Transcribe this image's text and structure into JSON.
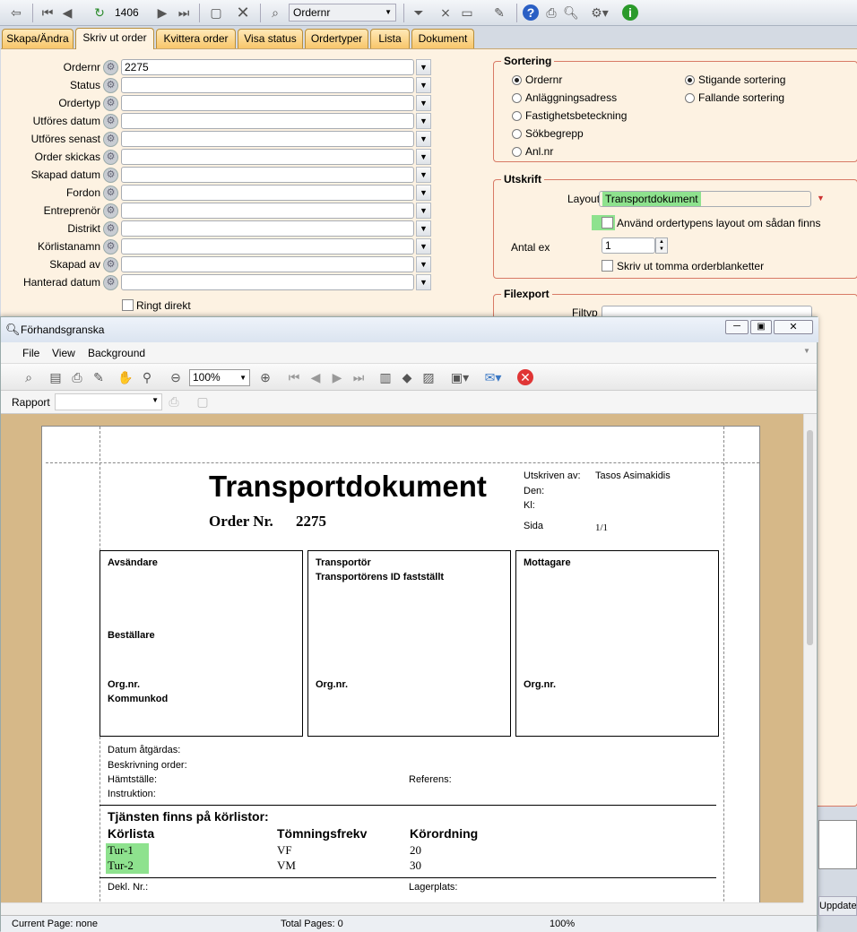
{
  "toolbar": {
    "record_counter": "1406",
    "search_field_value": "Ordernr"
  },
  "tabs": [
    "Skapa/Ändra",
    "Skriv ut order",
    "Kvittera order",
    "Visa status",
    "Ordertyper",
    "Lista",
    "Dokument"
  ],
  "form": {
    "fields": [
      {
        "label": "Ordernr",
        "value": "2275"
      },
      {
        "label": "Status",
        "value": ""
      },
      {
        "label": "Ordertyp",
        "value": ""
      },
      {
        "label": "Utföres datum",
        "value": ""
      },
      {
        "label": "Utföres senast",
        "value": ""
      },
      {
        "label": "Order skickas",
        "value": ""
      },
      {
        "label": "Skapad datum",
        "value": ""
      },
      {
        "label": "Fordon",
        "value": ""
      },
      {
        "label": "Entreprenör",
        "value": ""
      },
      {
        "label": "Distrikt",
        "value": ""
      },
      {
        "label": "Körlistanamn",
        "value": ""
      },
      {
        "label": "Skapad av",
        "value": ""
      },
      {
        "label": "Hanterad datum",
        "value": ""
      }
    ],
    "ringt_direkt": "Ringt direkt"
  },
  "sortering": {
    "title": "Sortering",
    "options": [
      "Ordernr",
      "Anläggningsadress",
      "Fastighetsbeteckning",
      "Sökbegrepp",
      "Anl.nr"
    ],
    "order_options": [
      "Stigande sortering",
      "Fallande sortering"
    ]
  },
  "utskrift": {
    "title": "Utskrift",
    "layout_label": "Layout",
    "layout_value": "Transportdokument",
    "use_type_layout": "Använd ordertypens layout om sådan finns",
    "antal_label": "Antal ex",
    "antal_value": "1",
    "print_empty": "Skriv ut tomma orderblanketter"
  },
  "filexport": {
    "title": "Filexport",
    "filtyp_label": "Filtyp"
  },
  "preview": {
    "title": "Förhandsgranska",
    "menu": [
      "File",
      "View",
      "Background"
    ],
    "zoom": "100%",
    "rapport_label": "Rapport",
    "status": [
      "Current Page: none",
      "Total Pages: 0",
      "100%"
    ],
    "side_label": "Uppdaterad"
  },
  "document": {
    "title": "Transportdokument",
    "order_label": "Order Nr.",
    "order_number": "2275",
    "printed_by_label": "Utskriven av:",
    "printed_by": "Tasos Asimakidis",
    "date_label": "Den:",
    "time_label": "Kl:",
    "page_label": "Sida",
    "page_value": "1/1",
    "sender": "Avsändare",
    "orderer": "Beställare",
    "orgnr": "Org.nr.",
    "kommunkod": "Kommunkod",
    "transporter": "Transportör",
    "transporter_id": "Transportörens ID fastställt",
    "receiver": "Mottagare",
    "date_action": "Datum åtgärdas:",
    "description": "Beskrivning order:",
    "pickup": "Hämtställe:",
    "reference": "Referens:",
    "instruction": "Instruktion:",
    "service_title": "Tjänsten finns på körlistor:",
    "columns": [
      "Körlista",
      "Tömningsfrekv",
      "Körordning"
    ],
    "rows": [
      {
        "list": "Tur-1",
        "freq": "VF",
        "order": "20"
      },
      {
        "list": "Tur-2",
        "freq": "VM",
        "order": "30"
      }
    ],
    "dekl": "Dekl. Nr.:",
    "lagerplats": "Lagerplats:"
  },
  "colors": {
    "tab_bg": "#f8c66a",
    "panel_bg": "#fdf2e2",
    "group_border": "#d87a66",
    "highlight": "#8ee28e",
    "canvas_bg": "#d6b888"
  }
}
